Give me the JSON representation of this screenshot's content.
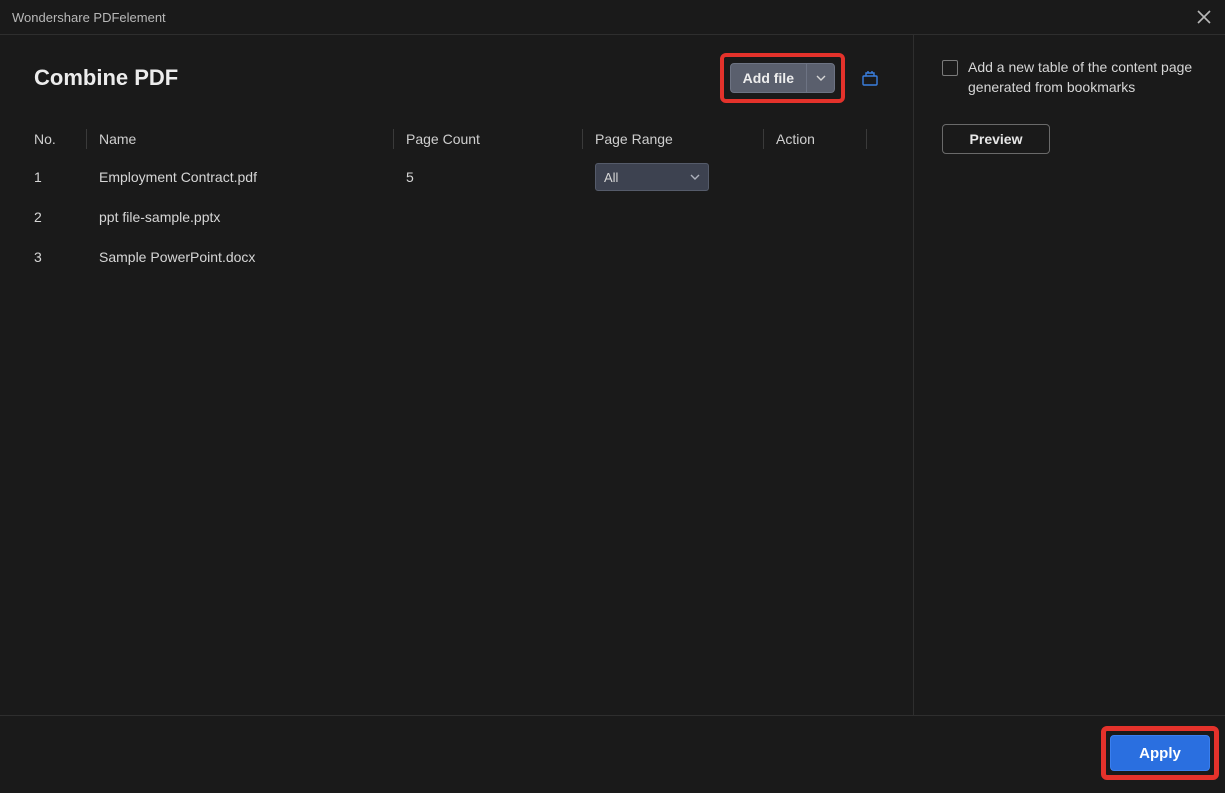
{
  "app_title": "Wondershare PDFelement",
  "heading": "Combine PDF",
  "add_file_label": "Add file",
  "columns": {
    "no": "No.",
    "name": "Name",
    "page_count": "Page Count",
    "page_range": "Page Range",
    "action": "Action"
  },
  "rows": [
    {
      "no": "1",
      "name": "Employment Contract.pdf",
      "page_count": "5",
      "range": "All"
    },
    {
      "no": "2",
      "name": "ppt file-sample.pptx",
      "page_count": "",
      "range": ""
    },
    {
      "no": "3",
      "name": "Sample PowerPoint.docx",
      "page_count": "",
      "range": ""
    }
  ],
  "sidebar": {
    "toc_checkbox_label": "Add a new table of the content page generated from bookmarks",
    "preview_label": "Preview"
  },
  "footer": {
    "apply_label": "Apply"
  }
}
